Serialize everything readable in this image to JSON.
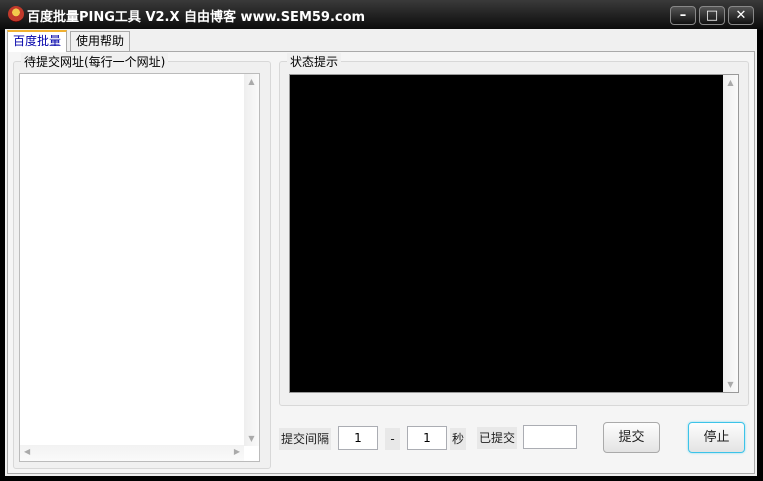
{
  "window": {
    "title": "百度批量PING工具 V2.X  自由博客 www.SEM59.com",
    "minimize": "–",
    "maximize": "□",
    "close": "✕"
  },
  "tabs": [
    {
      "label": "百度批量"
    },
    {
      "label": "使用帮助"
    }
  ],
  "left_group": {
    "label": "待提交网址(每行一个网址)",
    "value": ""
  },
  "right_group": {
    "label": "状态提示",
    "value": ""
  },
  "controls": {
    "interval_label": "提交间隔",
    "interval_min": "1",
    "dash": "-",
    "interval_max": "1",
    "unit": "秒",
    "submitted_label": "已提交",
    "submitted_value": "",
    "submit_button": "提交",
    "stop_button": "停止"
  },
  "colors": {
    "status_bg": "#000000",
    "active_tab": "#0000aa"
  }
}
